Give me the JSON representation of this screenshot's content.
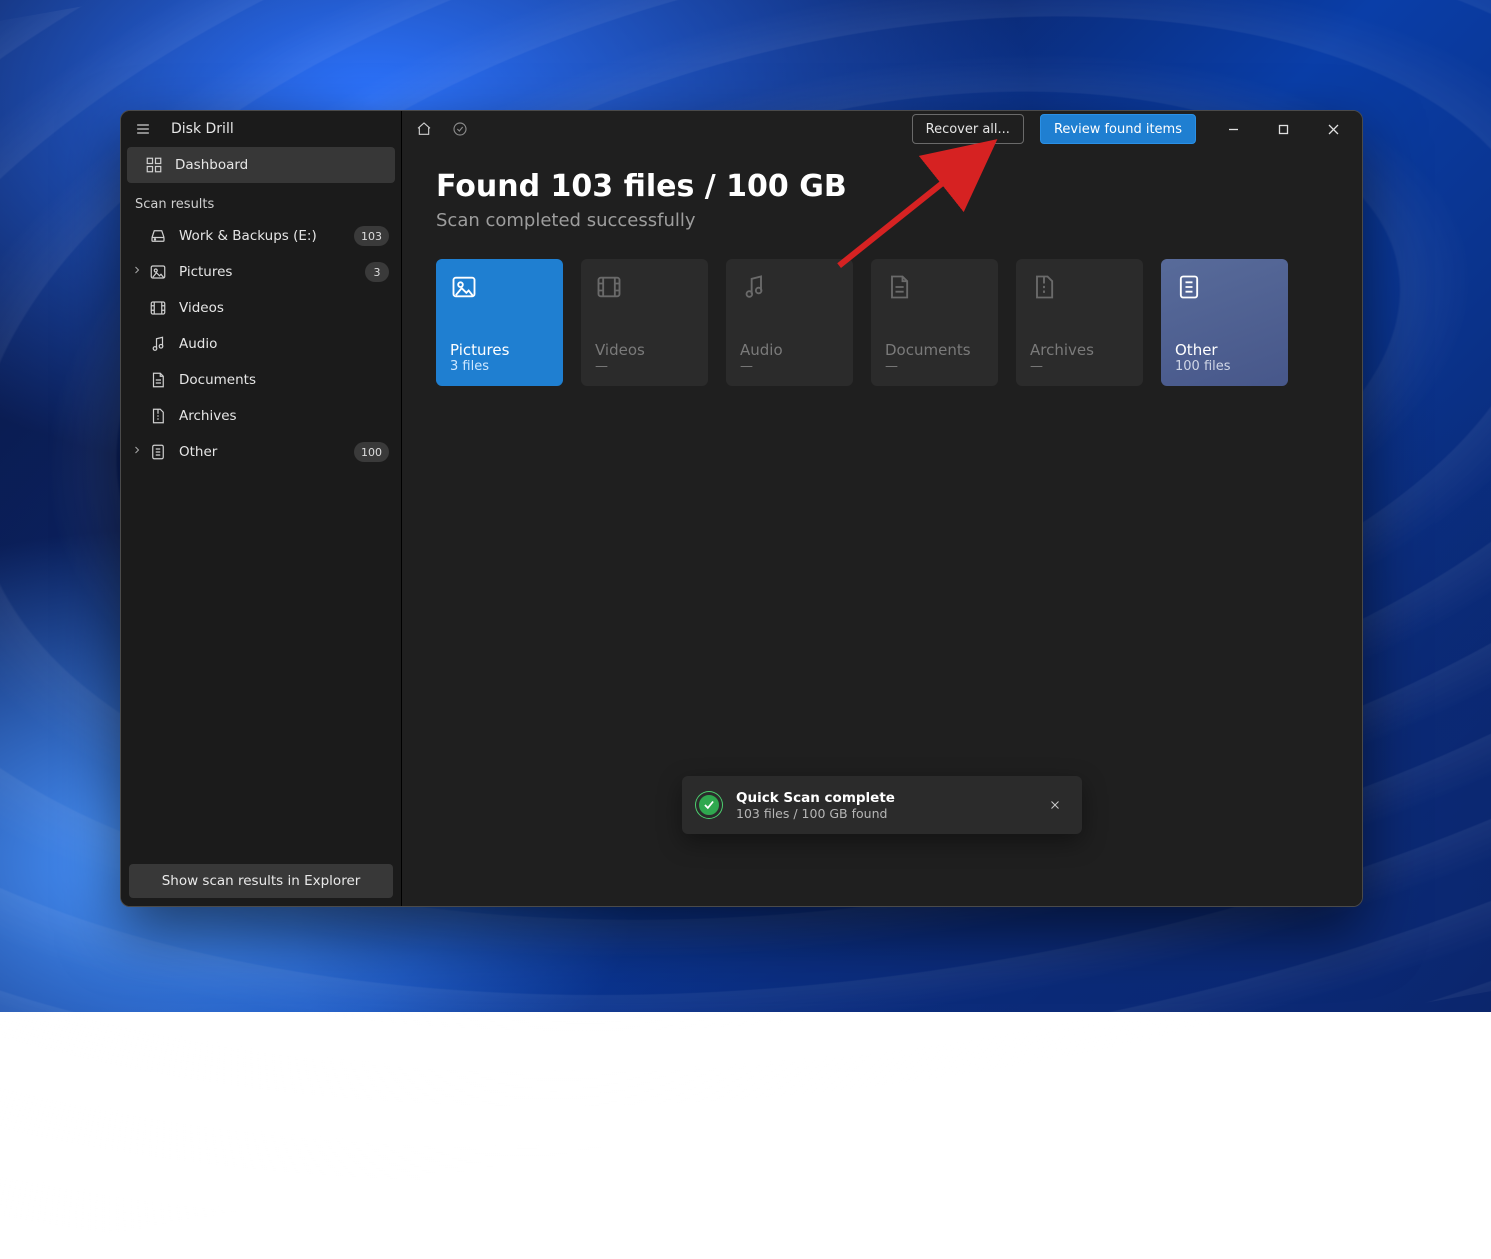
{
  "app": {
    "title": "Disk Drill"
  },
  "sidebar": {
    "dashboard": "Dashboard",
    "section": "Scan results",
    "items": [
      {
        "icon": "drive",
        "label": "Work & Backups (E:)",
        "badge": "103",
        "chev": false
      },
      {
        "icon": "image",
        "label": "Pictures",
        "badge": "3",
        "chev": true
      },
      {
        "icon": "video",
        "label": "Videos",
        "badge": "",
        "chev": false
      },
      {
        "icon": "audio",
        "label": "Audio",
        "badge": "",
        "chev": false
      },
      {
        "icon": "doc",
        "label": "Documents",
        "badge": "",
        "chev": false
      },
      {
        "icon": "archive",
        "label": "Archives",
        "badge": "",
        "chev": false
      },
      {
        "icon": "other",
        "label": "Other",
        "badge": "100",
        "chev": true
      }
    ],
    "explorer_button": "Show scan results in Explorer"
  },
  "topbar": {
    "recover": "Recover all...",
    "review": "Review found items"
  },
  "main": {
    "heading": "Found 103 files / 100 GB",
    "subheading": "Scan completed successfully",
    "cards": [
      {
        "style": "primary",
        "icon": "image",
        "title": "Pictures",
        "sub": "3 files"
      },
      {
        "style": "disabled",
        "icon": "video",
        "title": "Videos",
        "sub": "—"
      },
      {
        "style": "disabled",
        "icon": "audio",
        "title": "Audio",
        "sub": "—"
      },
      {
        "style": "disabled",
        "icon": "doc",
        "title": "Documents",
        "sub": "—"
      },
      {
        "style": "disabled",
        "icon": "archive",
        "title": "Archives",
        "sub": "—"
      },
      {
        "style": "other",
        "icon": "other",
        "title": "Other",
        "sub": "100 files"
      }
    ]
  },
  "toast": {
    "title": "Quick Scan complete",
    "sub": "103 files / 100 GB found"
  }
}
